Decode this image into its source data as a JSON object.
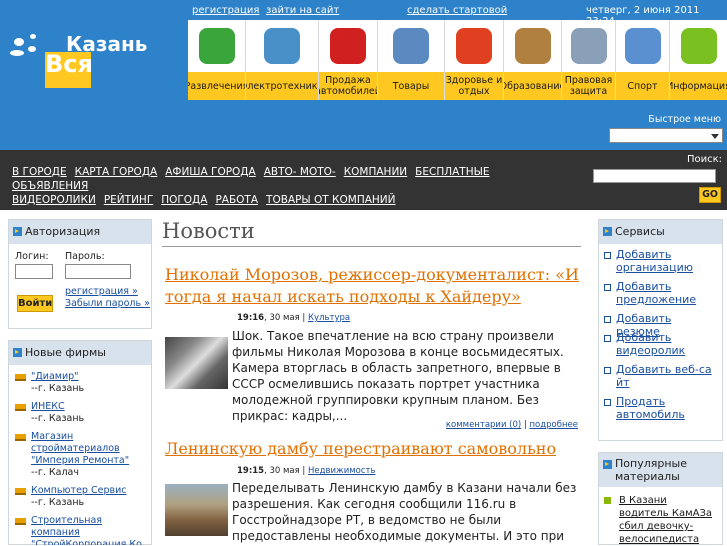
{
  "logo": {
    "word1": "Казань",
    "word2": "Вся"
  },
  "toplinks": {
    "register": "регистрация",
    "login": "зайти на сайт",
    "homepage": "сделать стартовой",
    "datetime": "четверг, 2 июня 2011  23:24"
  },
  "categories": [
    {
      "label": "Развлечения",
      "icon": "theater-masks-icon",
      "color": "#3aa53a"
    },
    {
      "label": "Электротехника",
      "icon": "fridge-icon",
      "color": "#4a90c8"
    },
    {
      "label": "Продажа автомобилей",
      "icon": "red-car-icon",
      "color": "#d02020"
    },
    {
      "label": "Товары",
      "icon": "cash-register-icon",
      "color": "#5a8ac0"
    },
    {
      "label": "Здоровье и отдых",
      "icon": "medical-cross-icon",
      "color": "#e04020"
    },
    {
      "label": "Образование",
      "icon": "owl-graduate-icon",
      "color": "#b08040"
    },
    {
      "label": "Правовая защита",
      "icon": "scales-icon",
      "color": "#8aa0b8"
    },
    {
      "label": "Спорт",
      "icon": "dumbbell-icon",
      "color": "#5a90d0"
    },
    {
      "label": "Информация",
      "icon": "pencil-icon",
      "color": "#7ac020"
    }
  ],
  "quick_menu": {
    "title": "Быстрое меню",
    "value": ""
  },
  "nav": {
    "items": [
      "В ГОРОДЕ",
      "КАРТА ГОРОДА",
      "АФИША ГОРОДА",
      "АВТО- МОТО-",
      "КОМПАНИИ",
      "БЕСПЛАТНЫЕ ОБЪЯВЛЕНИЯ",
      "ВИДЕОРОЛИКИ",
      "РЕЙТИНГ",
      "ПОГОДА",
      "РАБОТА",
      "ТОВАРЫ ОТ КОМПАНИЙ"
    ],
    "search_label": "Поиск:",
    "search_value": "",
    "go_label": "GO"
  },
  "auth": {
    "title": "Авторизация",
    "login_label": "Логин:",
    "password_label": "Пароль:",
    "login_value": "",
    "password_value": "",
    "submit": "Войти",
    "register": "регистрация »",
    "forgot": "Забыли пароль »"
  },
  "firms": {
    "title": "Новые фирмы",
    "items": [
      {
        "name": "\"Диамир\"",
        "city": "--г. Казань"
      },
      {
        "name": "ИНЕКС",
        "city": "--г. Казань"
      },
      {
        "name": "Магазин стройматериалов \"Империя Ремонта\"",
        "city": "--г. Калач"
      },
      {
        "name": "Компьютер Сервис",
        "city": "--г. Казань"
      },
      {
        "name": "Строительная компания \"СтройКорпорация Ко",
        "city": ""
      }
    ]
  },
  "news": {
    "title": "Новости",
    "articles": [
      {
        "title": "Николай Морозов, режиссер-документалист: «И тогда я начал искать подходы к Хайдеру»",
        "time": "19:16",
        "date": ", 30 мая |",
        "category": "Культура",
        "body": "Шок. Такое впечатление на всю страну произвели фильмы Николая Морозова в конце восьмидесятых. Камера вторглась в область запретного, впервые в СССР осмелившись показать портрет участника молодежной группировки крупным планом. Без прикрас: кадры,...",
        "comments": "комментарии (0)",
        "more": "подробнее"
      },
      {
        "title": "Ленинскую дамбу перестраивают самовольно",
        "time": "19:15",
        "date": ", 30 мая |",
        "category": "Недвижимость",
        "body": "Переделывать Ленинскую дамбу в Казани начали без разрешения. Как сегодня сообщили 116.ru в Госстройнадзоре РТ, в ведомство не были предоставлены необходимые документы. И это при том, что работы по реконструкции дамбы идут полным ходом..."
      }
    ]
  },
  "services": {
    "title": "Сервисы",
    "items": [
      "Добавить организацию",
      "Добавить предложение",
      "Добавить резюме",
      "Добавить видеоролик",
      "Добавить веб-сайт",
      "Продать автомобиль"
    ]
  },
  "popular": {
    "title": "Популярные материалы",
    "items": [
      "В Казани водитель КамАЗа сбил девочку-велосипедиста"
    ]
  }
}
